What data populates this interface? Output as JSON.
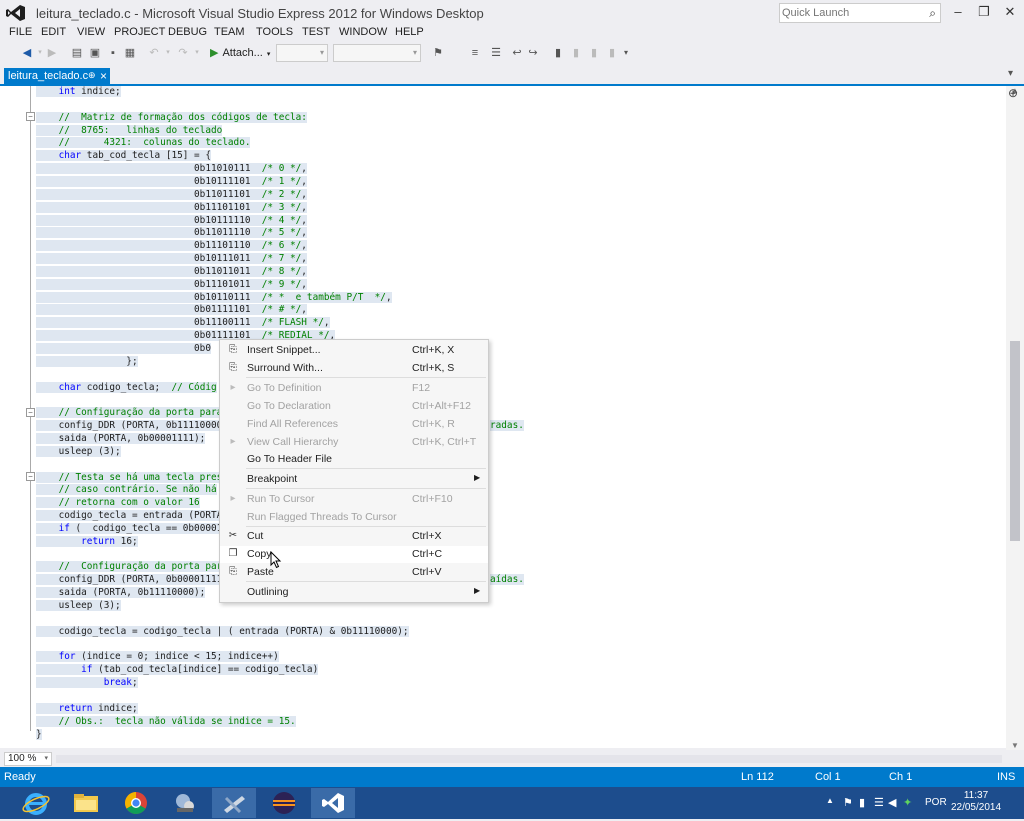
{
  "window": {
    "title": "leitura_teclado.c - Microsoft Visual Studio Express 2012 for Windows Desktop",
    "quick_launch_placeholder": "Quick Launch"
  },
  "menu": [
    "FILE",
    "EDIT",
    "VIEW",
    "PROJECT",
    "DEBUG",
    "TEAM",
    "TOOLS",
    "TEST",
    "WINDOW",
    "HELP"
  ],
  "toolbar": {
    "attach_label": "Attach..."
  },
  "tab": {
    "filename": "leitura_teclado.c"
  },
  "code_lines": [
    "    int indice;",
    "",
    "    //  Matriz de formação dos códigos de tecla:",
    "    //  8765:   linhas do teclado",
    "    //      4321:  colunas do teclado.",
    "    char tab_cod_tecla [15] = {",
    "                            0b11010111  /* 0 */,",
    "                            0b10111101  /* 1 */,",
    "                            0b11011101  /* 2 */,",
    "                            0b11101101  /* 3 */,",
    "                            0b10111110  /* 4 */,",
    "                            0b11011110  /* 5 */,",
    "                            0b11101110  /* 6 */,",
    "                            0b10111011  /* 7 */,",
    "                            0b11011011  /* 8 */,",
    "                            0b11101011  /* 9 */,",
    "                            0b10110111  /* *  e também P/T  */,",
    "                            0b01111101  /* # */,",
    "                            0b11100111  /* FLASH */,",
    "                            0b01111101  /* REDIAL */,",
    "                            0b0",
    "                };",
    "",
    "    char codigo_tecla;  // Códig",
    "",
    "    // Configuração da porta para",
    "    config_DDR (PORTA, 0b11110000",
    "    saida (PORTA, 0b00001111);",
    "    usleep (3);",
    "",
    "    // Testa se há uma tecla pres",
    "    // caso contrário. Se não há",
    "    // retorna com o valor 16",
    "    codigo_tecla = entrada (PORTA",
    "    if (  codigo_tecla == 0b00001",
    "        return 16;",
    "",
    "    //  Configuração da porta par",
    "    config_DDR (PORTA, 0b00001111",
    "    saida (PORTA, 0b11110000);",
    "    usleep (3);",
    "",
    "    codigo_tecla = codigo_tecla | ( entrada (PORTA) & 0b11110000);",
    "",
    "    for (indice = 0; indice < 15; indice++)",
    "        if (tab_cod_tecla[indice] == codigo_tecla)",
    "            break;",
    "",
    "    return indice;",
    "    // Obs.:  tecla não válida se indice = 15.",
    "}"
  ],
  "code_overflow": {
    "line26": "radas.",
    "line38": "aídas."
  },
  "context_menu": [
    {
      "label": "Insert Snippet...",
      "shortcut": "Ctrl+K, X",
      "enabled": true,
      "icon": "snippet-icon"
    },
    {
      "label": "Surround With...",
      "shortcut": "Ctrl+K, S",
      "enabled": true,
      "icon": "surround-icon"
    },
    {
      "label": "Go To Definition",
      "shortcut": "F12",
      "enabled": false,
      "icon": "goto-definition-icon"
    },
    {
      "label": "Go To Declaration",
      "shortcut": "Ctrl+Alt+F12",
      "enabled": false,
      "icon": ""
    },
    {
      "label": "Find All References",
      "shortcut": "Ctrl+K, R",
      "enabled": false,
      "icon": ""
    },
    {
      "label": "View Call Hierarchy",
      "shortcut": "Ctrl+K, Ctrl+T",
      "enabled": false,
      "icon": "call-hierarchy-icon"
    },
    {
      "label": "Go To Header File",
      "shortcut": "",
      "enabled": true,
      "icon": ""
    },
    {
      "label": "Breakpoint",
      "shortcut": "",
      "enabled": true,
      "icon": "",
      "submenu": true
    },
    {
      "label": "Run To Cursor",
      "shortcut": "Ctrl+F10",
      "enabled": false,
      "icon": "run-to-cursor-icon"
    },
    {
      "label": "Run Flagged Threads To Cursor",
      "shortcut": "",
      "enabled": false,
      "icon": ""
    },
    {
      "label": "Cut",
      "shortcut": "Ctrl+X",
      "enabled": true,
      "icon": "scissors-icon"
    },
    {
      "label": "Copy",
      "shortcut": "Ctrl+C",
      "enabled": true,
      "icon": "copy-icon",
      "hover": true
    },
    {
      "label": "Paste",
      "shortcut": "Ctrl+V",
      "enabled": true,
      "icon": "paste-icon"
    },
    {
      "label": "Outlining",
      "shortcut": "",
      "enabled": true,
      "icon": "",
      "submenu": true
    }
  ],
  "zoom": "100 %",
  "status": {
    "state": "Ready",
    "line": "Ln 112",
    "col": "Col 1",
    "ch": "Ch 1",
    "mode": "INS"
  },
  "taskbar": {
    "language": "POR",
    "time": "11:37",
    "date": "22/05/2014"
  },
  "colors": {
    "accent": "#007acc",
    "selection": "#dfe7f1",
    "keyword": "#0000ff",
    "comment": "#008000",
    "taskbar": "#1d4d8d"
  }
}
